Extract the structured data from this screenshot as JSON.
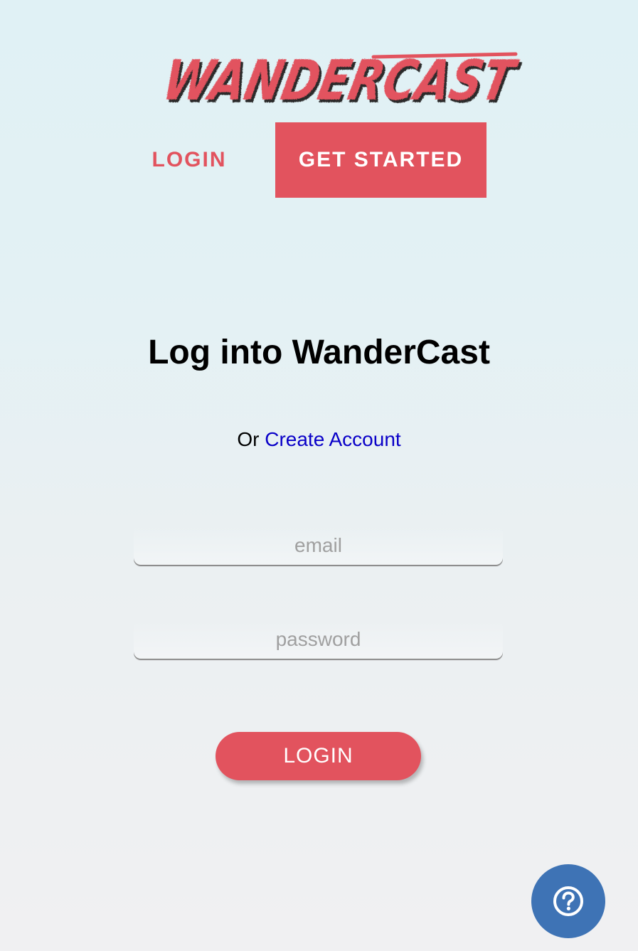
{
  "brand": {
    "logo_text": "WanderCast",
    "accent_color": "#e2535e"
  },
  "nav": {
    "login_label": "LOGIN",
    "get_started_label": "GET STARTED"
  },
  "main": {
    "title": "Log into WanderCast",
    "or_text": "Or",
    "create_account_label": "Create Account"
  },
  "form": {
    "email_placeholder": "email",
    "email_value": "",
    "password_placeholder": "password",
    "password_value": "",
    "submit_label": "LOGIN"
  },
  "help": {
    "icon": "question-circle-icon",
    "color": "#3e73b5"
  }
}
